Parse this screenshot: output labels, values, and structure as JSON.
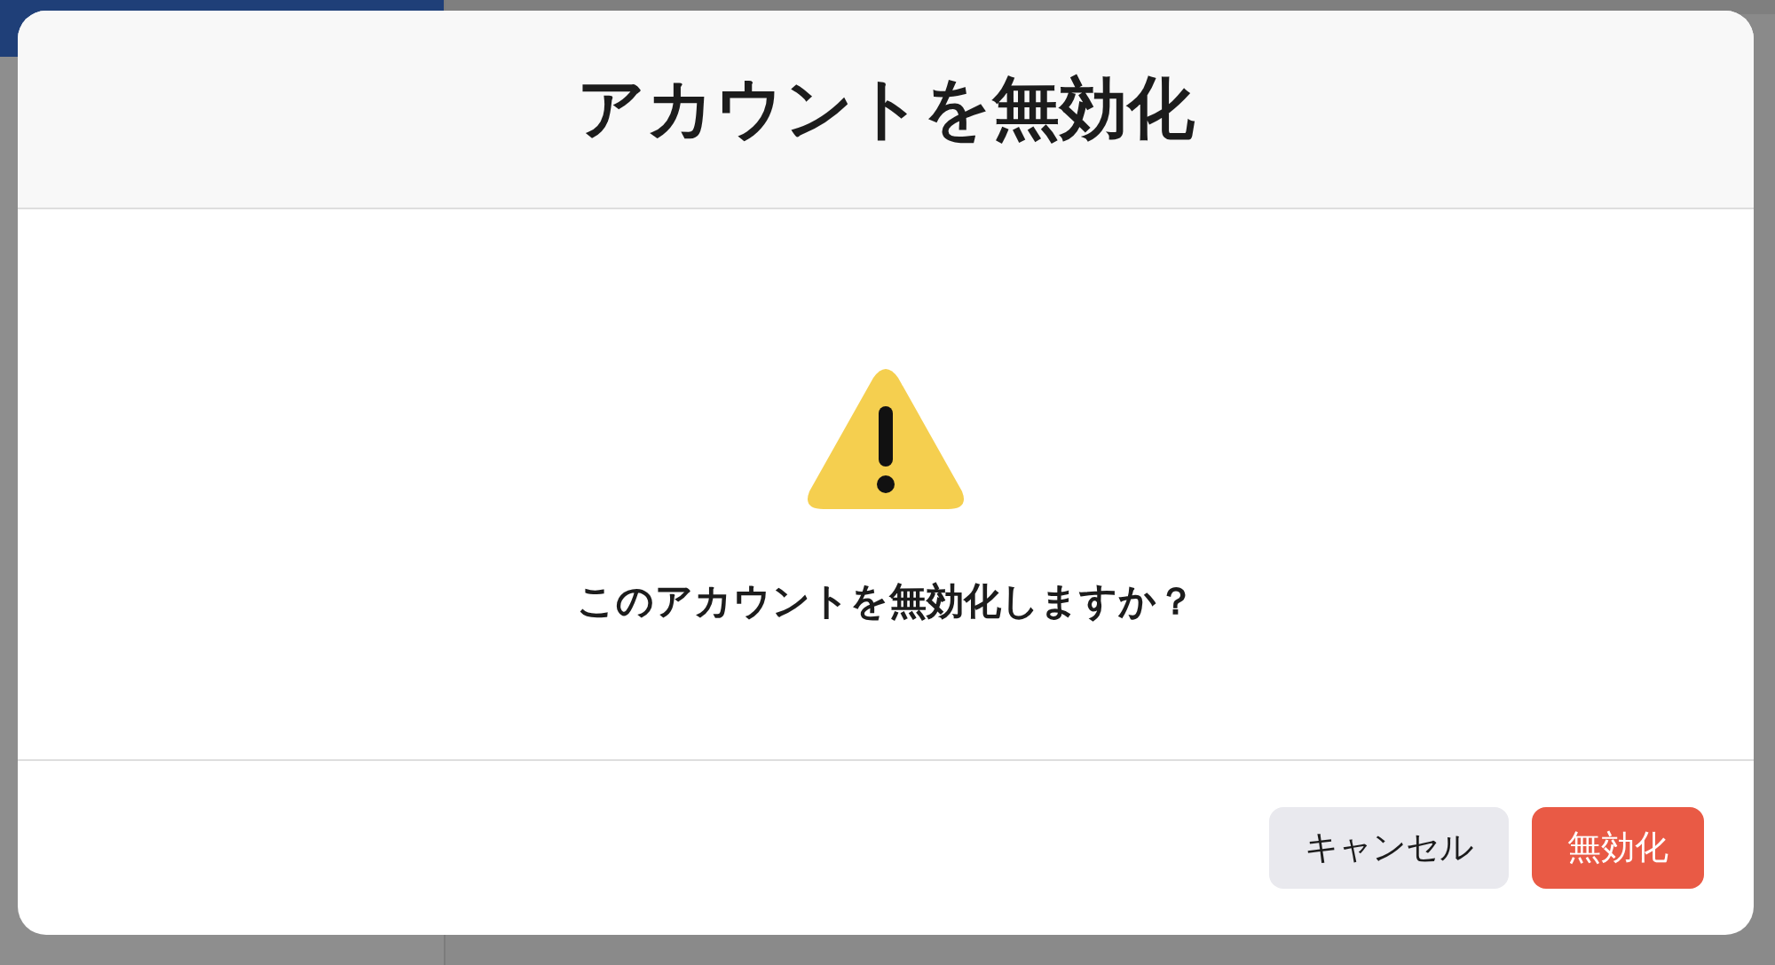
{
  "dialog": {
    "title": "アカウントを無効化",
    "message": "このアカウントを無効化しますか？",
    "buttons": [
      {
        "label": "キャンセル",
        "kind": "secondary"
      },
      {
        "label": "無効化",
        "kind": "danger"
      }
    ]
  }
}
